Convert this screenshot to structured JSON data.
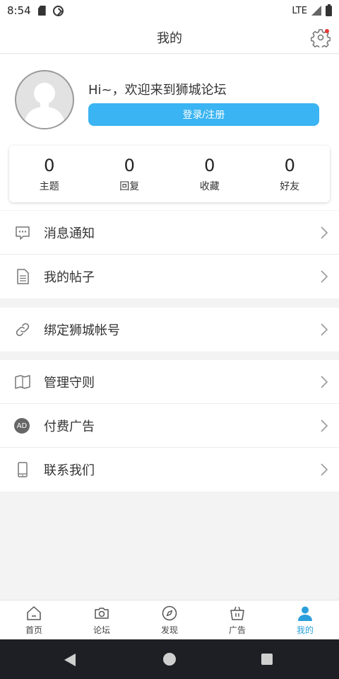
{
  "status_bar": {
    "time": "8:54",
    "network": "LTE"
  },
  "header": {
    "title": "我的"
  },
  "profile": {
    "greeting": "Hi~，欢迎来到狮城论坛",
    "login_label": "登录/注册"
  },
  "stats": [
    {
      "value": "0",
      "label": "主题"
    },
    {
      "value": "0",
      "label": "回复"
    },
    {
      "value": "0",
      "label": "收藏"
    },
    {
      "value": "0",
      "label": "好友"
    }
  ],
  "menu": {
    "notifications": "消息通知",
    "my_posts": "我的帖子",
    "bind_account": "绑定狮城帐号",
    "rules": "管理守则",
    "paid_ads": "付费广告",
    "paid_ads_icon_text": "AD",
    "contact": "联系我们"
  },
  "bottom_nav": [
    {
      "label": "首页",
      "icon": "home-icon"
    },
    {
      "label": "论坛",
      "icon": "camera-icon"
    },
    {
      "label": "发现",
      "icon": "compass-icon"
    },
    {
      "label": "广告",
      "icon": "basket-icon"
    },
    {
      "label": "我的",
      "icon": "person-icon",
      "active": true
    }
  ],
  "colors": {
    "accent": "#3ab4f2",
    "active_nav": "#2a9fdc",
    "badge": "#e53935"
  }
}
